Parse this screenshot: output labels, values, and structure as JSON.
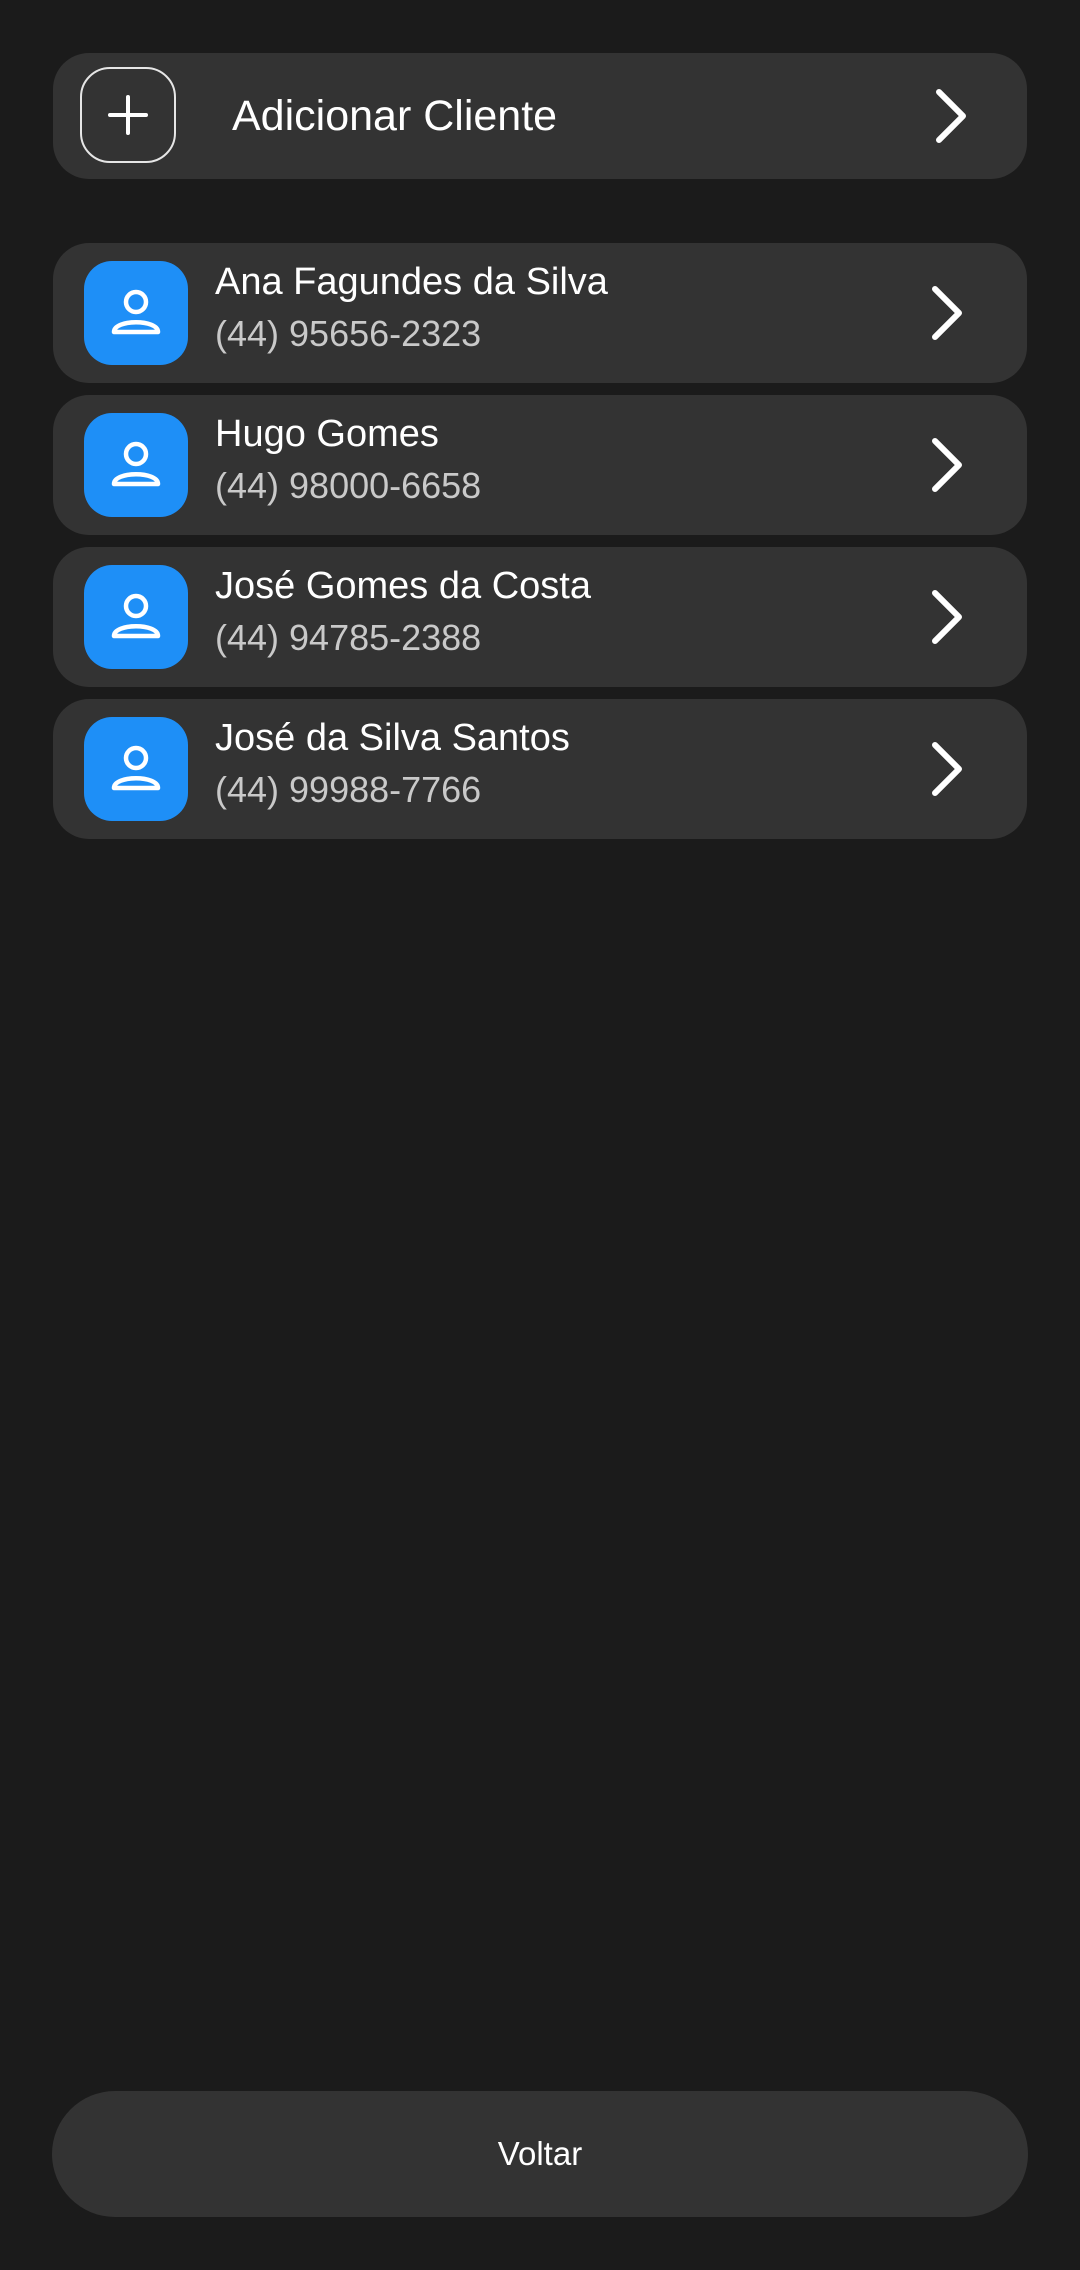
{
  "add_client": {
    "label": "Adicionar Cliente",
    "icon": "plus-icon",
    "action_icon": "chevron-right-icon"
  },
  "clients": [
    {
      "name": "Ana Fagundes da Silva",
      "phone": "(44) 95656-2323",
      "icon": "person-icon"
    },
    {
      "name": "Hugo Gomes",
      "phone": "(44) 98000-6658",
      "icon": "person-icon"
    },
    {
      "name": "José Gomes da Costa",
      "phone": "(44) 94785-2388",
      "icon": "person-icon"
    },
    {
      "name": "José da Silva Santos",
      "phone": "(44) 99988-7766",
      "icon": "person-icon"
    }
  ],
  "footer": {
    "back_label": "Voltar"
  },
  "colors": {
    "background": "#1b1b1b",
    "card": "#333333",
    "accent": "#1e8ff7",
    "text_primary": "#ffffff",
    "text_secondary": "#c9c9c9"
  }
}
